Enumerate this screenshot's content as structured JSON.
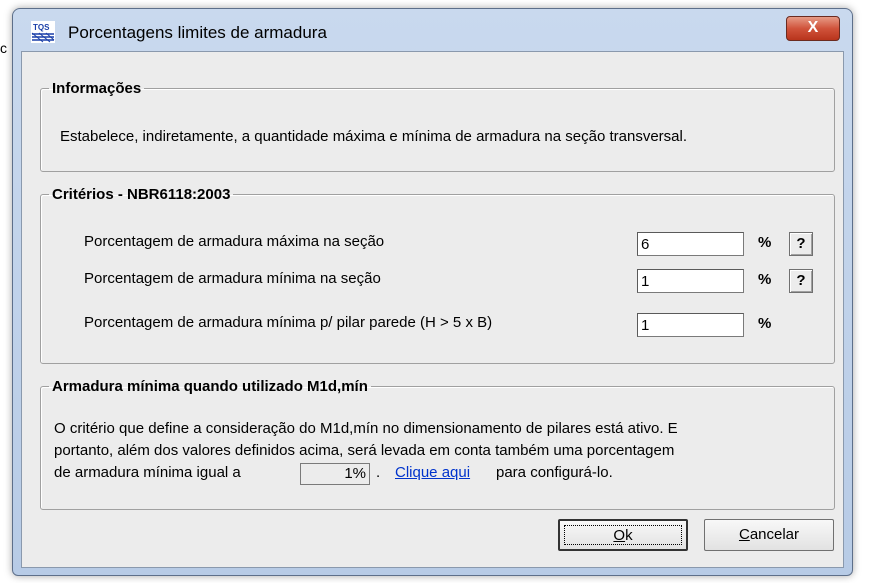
{
  "background": {
    "left_text": "c"
  },
  "window": {
    "title": "Porcentagens limites de armadura",
    "close_label": "X",
    "icon_name": "tqs-logo-icon"
  },
  "info": {
    "legend": "Informações",
    "text": "Estabelece, indiretamente, a quantidade máxima e mínima de armadura na seção transversal."
  },
  "criteria": {
    "legend": "Critérios - NBR6118:2003",
    "rows": [
      {
        "label": "Porcentagem de armadura máxima na seção",
        "value": "6",
        "unit": "%",
        "help": "?"
      },
      {
        "label": "Porcentagem de armadura mínima na seção",
        "value": "1",
        "unit": "%",
        "help": "?"
      },
      {
        "label": "Porcentagem de armadura mínima p/ pilar parede (H > 5 x B)",
        "value": "1",
        "unit": "%"
      }
    ]
  },
  "m1d": {
    "legend": "Armadura mínima quando utilizado M1d,mín",
    "line1": "O critério que define a consideração do M1d,mín no dimensionamento de pilares está ativo. E",
    "line2": "portanto, além dos valores definidos acima, será levada em conta também uma porcentagem",
    "line3_prefix": "de armadura mínima igual a",
    "min_value": "1%",
    "separator": ".",
    "link_text": "Clique aqui",
    "line3_suffix": "para configurá-lo."
  },
  "buttons": {
    "ok_hotkey": "O",
    "ok_rest": "k",
    "cancel_hotkey": "C",
    "cancel_rest": "ancelar"
  },
  "colors": {
    "link": "#0033cc",
    "close": "#d0533b",
    "titlebar": "#c9d9ee"
  }
}
